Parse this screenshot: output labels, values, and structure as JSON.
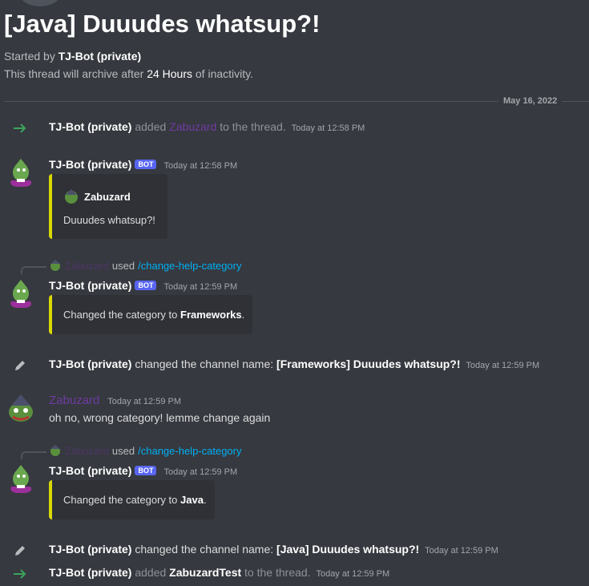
{
  "thread": {
    "title": "[Java] Duuudes whatsup?!",
    "started_prefix": "Started by",
    "started_by": "TJ-Bot (private)",
    "archive_prefix": "This thread will archive after",
    "archive_duration": "24 Hours",
    "archive_suffix": "of inactivity."
  },
  "divider_date": "May 16, 2022",
  "messages": {
    "m1": {
      "name": "TJ-Bot (private)",
      "verb": "added",
      "target": "Zabuzard",
      "suffix": "to the thread.",
      "time": "Today at 12:58 PM"
    },
    "m2": {
      "name": "TJ-Bot (private)",
      "badge": "BOT",
      "time": "Today at 12:58 PM",
      "embed_author": "Zabuzard",
      "embed_text": "Duuudes whatsup?!"
    },
    "m3": {
      "reply_user": "Zabuzard",
      "reply_used": "used",
      "reply_cmd": "/change-help-category",
      "name": "TJ-Bot (private)",
      "badge": "BOT",
      "time": "Today at 12:59 PM",
      "embed_prefix": "Changed the category to",
      "embed_value": "Frameworks",
      "embed_suffix": "."
    },
    "m4": {
      "name": "TJ-Bot (private)",
      "text": "changed the channel name:",
      "value": "[Frameworks] Duuudes whatsup?!",
      "time": "Today at 12:59 PM"
    },
    "m5": {
      "name": "Zabuzard",
      "time": "Today at 12:59 PM",
      "text": "oh no, wrong category! lemme change again"
    },
    "m6": {
      "reply_user": "Zabuzard",
      "reply_used": "used",
      "reply_cmd": "/change-help-category",
      "name": "TJ-Bot (private)",
      "badge": "BOT",
      "time": "Today at 12:59 PM",
      "embed_prefix": "Changed the category to",
      "embed_value": "Java",
      "embed_suffix": "."
    },
    "m7": {
      "name": "TJ-Bot (private)",
      "text": "changed the channel name:",
      "value": "[Java] Duuudes whatsup?!",
      "time": "Today at 12:59 PM"
    },
    "m8": {
      "name": "TJ-Bot (private)",
      "verb": "added",
      "target": "ZabuzardTest",
      "suffix": "to the thread.",
      "time": "Today at 12:59 PM"
    }
  },
  "icons": {
    "join": "arrow-right-icon",
    "rename": "pencil-icon"
  },
  "colors": {
    "background": "#36393f",
    "embed_border": "#d8d805",
    "bot_badge": "#5865f2",
    "link": "#00aff4",
    "zabuzard_name": "#6f3ba2"
  }
}
